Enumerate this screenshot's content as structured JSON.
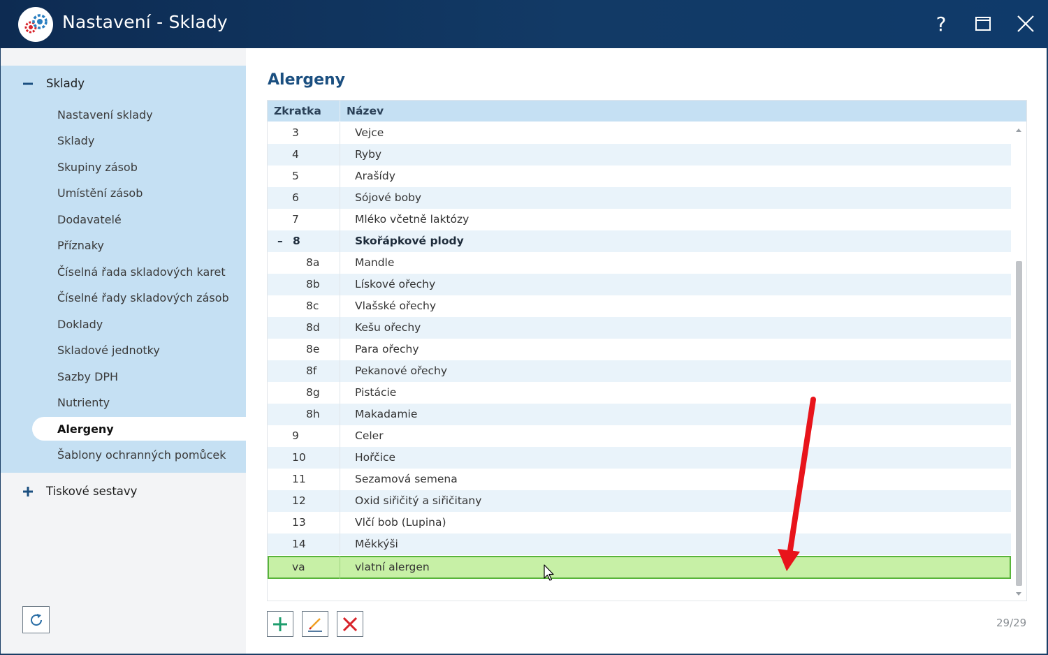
{
  "window": {
    "title": "Nastavení - Sklady",
    "help_label": "?",
    "icon": "settings-gears-icon"
  },
  "sidebar": {
    "groups": [
      {
        "label": "Sklady",
        "expanded": true,
        "toggle_icon": "minus-icon",
        "items": [
          {
            "label": "Nastavení sklady"
          },
          {
            "label": "Sklady"
          },
          {
            "label": "Skupiny zásob"
          },
          {
            "label": "Umístění zásob"
          },
          {
            "label": "Dodavatelé"
          },
          {
            "label": "Příznaky"
          },
          {
            "label": "Číselná řada skladových karet"
          },
          {
            "label": "Číselné řady skladových zásob"
          },
          {
            "label": "Doklady"
          },
          {
            "label": "Skladové jednotky"
          },
          {
            "label": "Sazby DPH"
          },
          {
            "label": "Nutrienty"
          },
          {
            "label": "Alergeny",
            "active": true
          },
          {
            "label": "Šablony ochranných pomůcek"
          }
        ]
      },
      {
        "label": "Tiskové sestavy",
        "expanded": false,
        "toggle_icon": "plus-icon"
      }
    ],
    "refresh_icon": "refresh-icon"
  },
  "main": {
    "title": "Alergeny",
    "columns": [
      "Zkratka",
      "Název"
    ],
    "rows": [
      {
        "code": "3",
        "name": "Vejce",
        "level": 0
      },
      {
        "code": "4",
        "name": "Ryby",
        "level": 0
      },
      {
        "code": "5",
        "name": "Arašídy",
        "level": 0
      },
      {
        "code": "6",
        "name": "Sójové boby",
        "level": 0
      },
      {
        "code": "7",
        "name": "Mléko včetně laktózy",
        "level": 0
      },
      {
        "code": "8",
        "name": "Skořápkové plody",
        "level": 0,
        "group": true,
        "expanded": true,
        "toggle": "–"
      },
      {
        "code": "8a",
        "name": "Mandle",
        "level": 1
      },
      {
        "code": "8b",
        "name": "Lískové ořechy",
        "level": 1
      },
      {
        "code": "8c",
        "name": "Vlašské ořechy",
        "level": 1
      },
      {
        "code": "8d",
        "name": "Kešu ořechy",
        "level": 1
      },
      {
        "code": "8e",
        "name": "Para ořechy",
        "level": 1
      },
      {
        "code": "8f",
        "name": "Pekanové ořechy",
        "level": 1
      },
      {
        "code": "8g",
        "name": "Pistácie",
        "level": 1
      },
      {
        "code": "8h",
        "name": "Makadamie",
        "level": 1
      },
      {
        "code": "9",
        "name": "Celer",
        "level": 0
      },
      {
        "code": "10",
        "name": "Hořčice",
        "level": 0
      },
      {
        "code": "11",
        "name": "Sezamová semena",
        "level": 0
      },
      {
        "code": "12",
        "name": "Oxid siřičitý a siřičitany",
        "level": 0
      },
      {
        "code": "13",
        "name": "Vlčí bob (Lupina)",
        "level": 0
      },
      {
        "code": "14",
        "name": "Měkkýši",
        "level": 0
      },
      {
        "code": "va",
        "name": "vlatní alergen",
        "level": 0,
        "selected": true
      }
    ],
    "toolbar": {
      "add_icon": "plus-icon",
      "edit_icon": "pencil-icon",
      "delete_icon": "x-icon"
    },
    "counter": "29/29"
  },
  "colors": {
    "titlebar": "#0d2b52",
    "sidebar_highlight": "#c5e0f3",
    "heading": "#1b4f80",
    "selected_row": "#c7f0a6",
    "selected_border": "#58b43a",
    "annotation_arrow": "#e8141b",
    "add_green": "#1f9e6e",
    "delete_red": "#d8232a"
  }
}
